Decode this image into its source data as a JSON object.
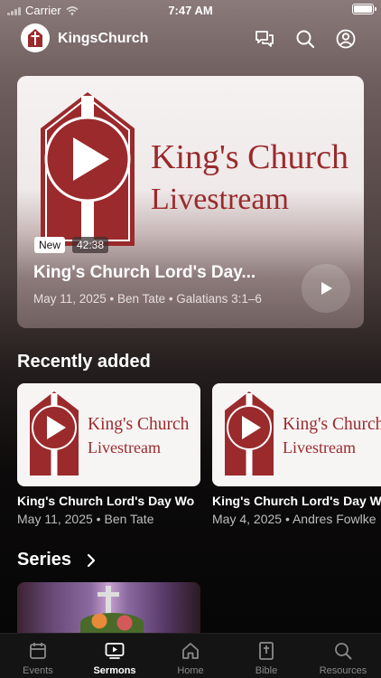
{
  "status_bar": {
    "carrier": "Carrier",
    "time": "7:47 AM"
  },
  "header": {
    "app_name": "KingsChurch"
  },
  "hero": {
    "artwork_line1": "King's Church",
    "artwork_line2": "Livestream",
    "badge_new": "New",
    "duration": "42:38",
    "title": "King's Church Lord's Day...",
    "meta": "May 11, 2025 • Ben Tate • Galatians 3:1–6"
  },
  "recently_added": {
    "heading": "Recently added",
    "items": [
      {
        "artwork_line1": "King's Church",
        "artwork_line2": "Livestream",
        "title": "King's Church Lord's Day Wo",
        "meta": "May 11, 2025 • Ben Tate"
      },
      {
        "artwork_line1": "King's Church",
        "artwork_line2": "Livestream",
        "title": "King's Church Lord's Day W",
        "meta": "May 4, 2025 • Andres Fowlke"
      }
    ]
  },
  "series": {
    "heading": "Series"
  },
  "tabs": [
    {
      "label": "Events",
      "icon": "calendar-icon"
    },
    {
      "label": "Sermons",
      "icon": "tv-play-icon",
      "active": true
    },
    {
      "label": "Home",
      "icon": "home-icon"
    },
    {
      "label": "Bible",
      "icon": "bible-icon"
    },
    {
      "label": "Resources",
      "icon": "search-icon"
    }
  ],
  "colors": {
    "brand_red": "#9a2a2c",
    "tab_bar": "#141414"
  }
}
